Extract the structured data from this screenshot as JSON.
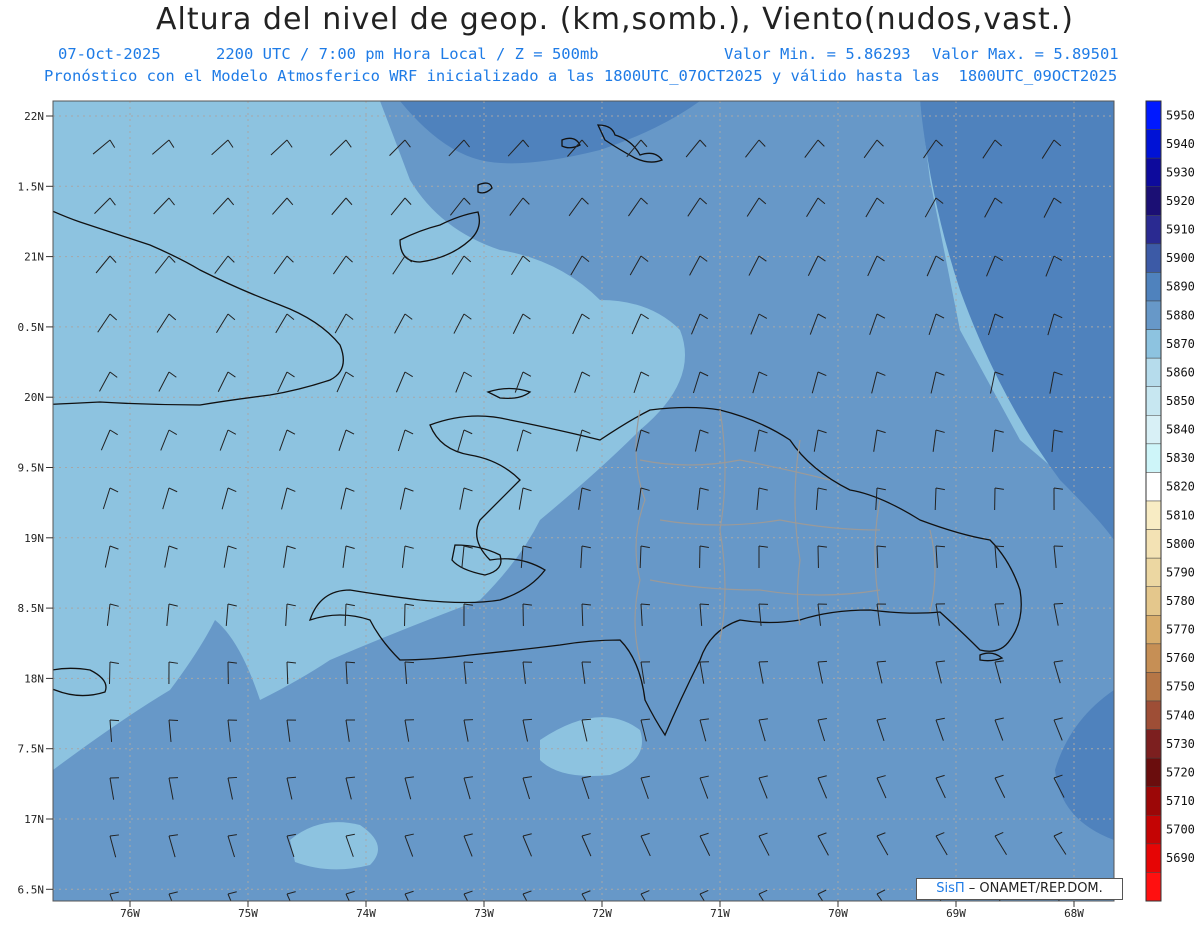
{
  "header": {
    "title": "Altura del nivel de geop. (km,somb.), Viento(nudos,vast.)",
    "date_label": "07-Oct-2025",
    "time_label": "2200 UTC / 7:00 pm Hora Local / Z = 500mb",
    "min_label": "Valor Min. = 5.86293",
    "max_label": "Valor Max. = 5.89501",
    "model_label": "Pronóstico con el Modelo Atmosferico WRF inicializado a las 1800UTC_07OCT2025 y válido hasta las  1800UTC_09OCT2025"
  },
  "map": {
    "lat_ticks": [
      "22N",
      "1.5N",
      "21N",
      "0.5N",
      "20N",
      "9.5N",
      "19N",
      "8.5N",
      "18N",
      "7.5N",
      "17N",
      "6.5N"
    ],
    "lon_ticks": [
      "76W",
      "75W",
      "74W",
      "73W",
      "72W",
      "71W",
      "70W",
      "69W",
      "68W"
    ],
    "lat_range": [
      16.5,
      22
    ],
    "lon_range": [
      -76.6,
      -67.6
    ],
    "background_color": "#8dc3e0"
  },
  "colorbar": {
    "levels": [
      {
        "label": "5950",
        "color": "#0019ff"
      },
      {
        "label": "5940",
        "color": "#0012d6"
      },
      {
        "label": "5930",
        "color": "#0d0a9c"
      },
      {
        "label": "5920",
        "color": "#1b0f74"
      },
      {
        "label": "5910",
        "color": "#2a2a91"
      },
      {
        "label": "5900",
        "color": "#3c5aa6"
      },
      {
        "label": "5890",
        "color": "#4f82bd"
      },
      {
        "label": "5880",
        "color": "#6798c8"
      },
      {
        "label": "5870",
        "color": "#8dc3e0"
      },
      {
        "label": "5860",
        "color": "#b6dcec"
      },
      {
        "label": "5850",
        "color": "#c7e7f1"
      },
      {
        "label": "5840",
        "color": "#d8f0f6"
      },
      {
        "label": "5830",
        "color": "#cef5f9"
      },
      {
        "label": "5820",
        "color": "#ffffff"
      },
      {
        "label": "5810",
        "color": "#f8ecc4"
      },
      {
        "label": "5800",
        "color": "#f3e2b4"
      },
      {
        "label": "5790",
        "color": "#ecd7a2"
      },
      {
        "label": "5780",
        "color": "#e4c78c"
      },
      {
        "label": "5770",
        "color": "#d8ad6c"
      },
      {
        "label": "5760",
        "color": "#c68f55"
      },
      {
        "label": "5750",
        "color": "#b57646"
      },
      {
        "label": "5740",
        "color": "#9e4e36"
      },
      {
        "label": "5730",
        "color": "#7c1f1f"
      },
      {
        "label": "5720",
        "color": "#6a0d0d"
      },
      {
        "label": "5710",
        "color": "#9c0707"
      },
      {
        "label": "5700",
        "color": "#c40404"
      },
      {
        "label": "5690",
        "color": "#e60505"
      },
      {
        "label": "",
        "color": "#ff1010"
      }
    ]
  },
  "credit": {
    "brand": "SisΠ",
    "text": "– ONAMET/REP.DOM."
  }
}
